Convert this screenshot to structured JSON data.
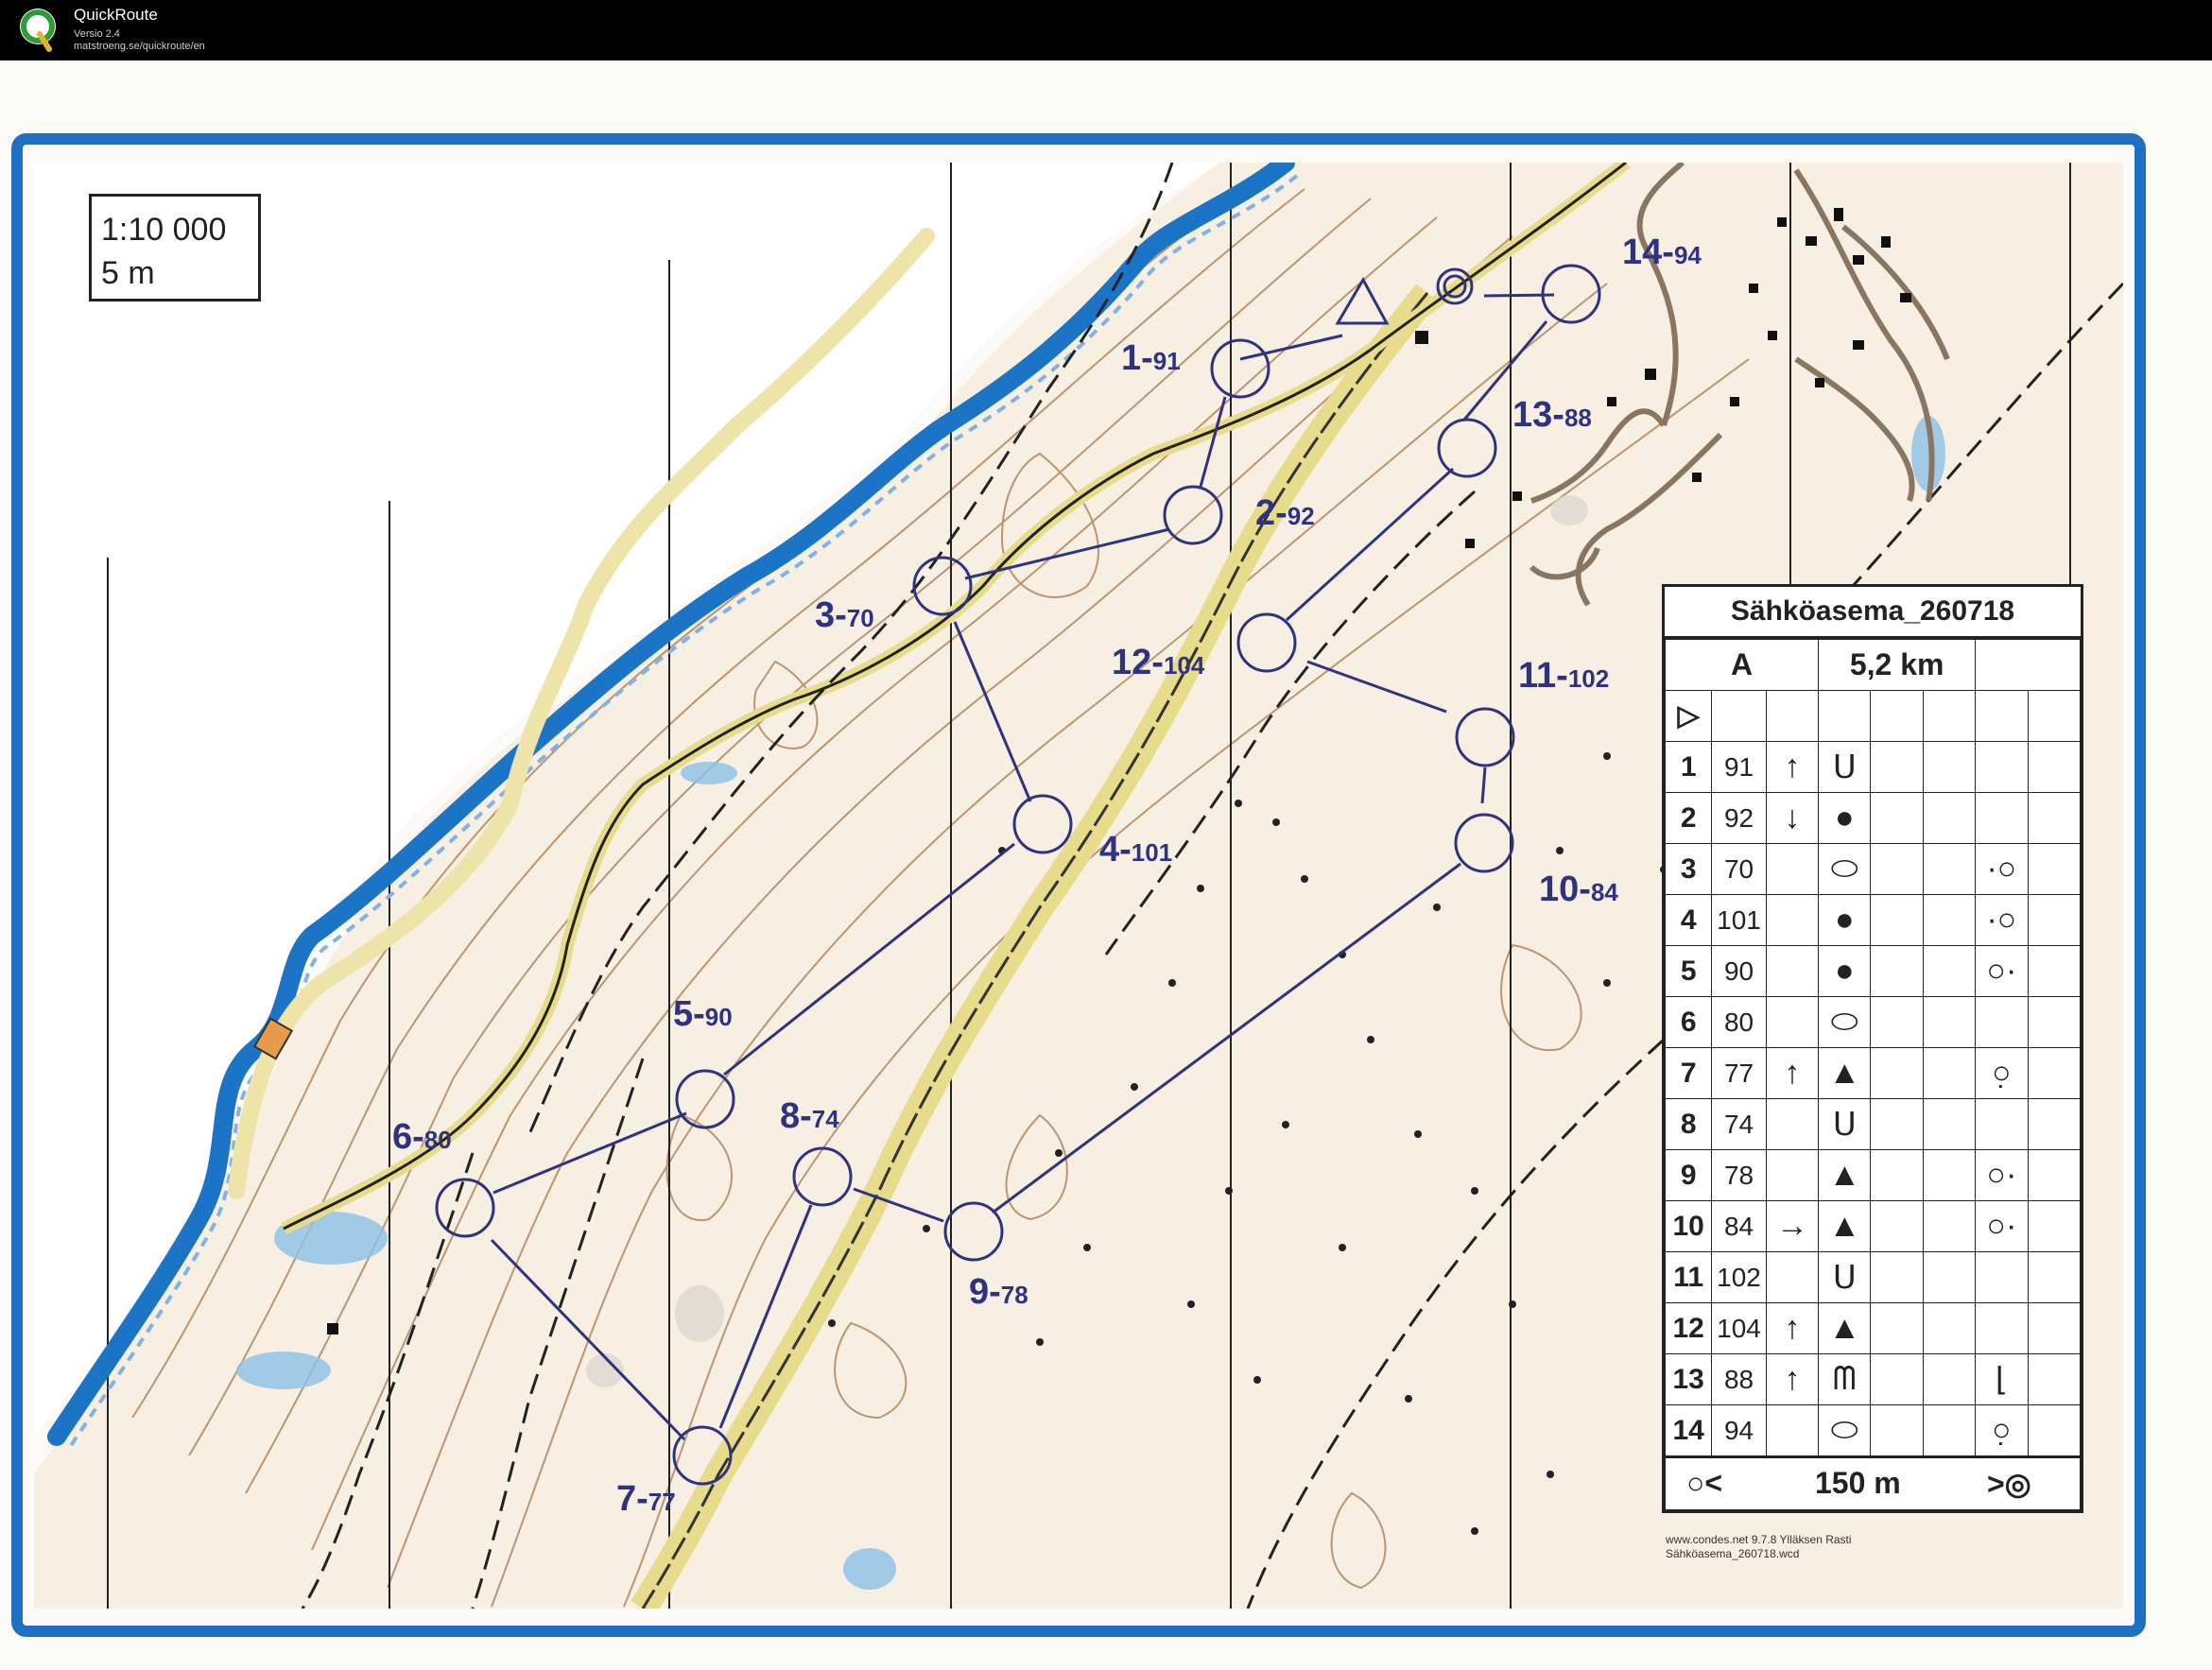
{
  "app": {
    "name": "QuickRoute",
    "version": "Versio 2.4",
    "url": "matstroeng.se/quickroute/en"
  },
  "map": {
    "scale": "1:10 000",
    "contour": "5 m",
    "course_title": "Sähköasema_260718",
    "class": "A",
    "length": "5,2 km",
    "start_symbol": "▷",
    "footer_left_symbol": "○<",
    "footer_distance": "150 m",
    "footer_right_symbol": ">◎",
    "software_note": "www.condes.net 9.7.8 Ylläksen Rasti",
    "file_name": "Sähköasema_260718.wcd",
    "colors": {
      "frame": "#1f6fc2",
      "water": "#1c74c6",
      "contours": "#a9774a",
      "course": "#2e3280",
      "track": "#e6dc8c"
    }
  },
  "controls": [
    {
      "num": "1",
      "code": "91",
      "dir": "↑",
      "feature": "ᑌ",
      "pos": ""
    },
    {
      "num": "2",
      "code": "92",
      "dir": "↓",
      "feature": "●",
      "pos": ""
    },
    {
      "num": "3",
      "code": "70",
      "dir": "",
      "feature": "⬭",
      "pos": "·○"
    },
    {
      "num": "4",
      "code": "101",
      "dir": "",
      "feature": "●",
      "pos": "·○"
    },
    {
      "num": "5",
      "code": "90",
      "dir": "",
      "feature": "●",
      "pos": "○·"
    },
    {
      "num": "6",
      "code": "80",
      "dir": "",
      "feature": "⬭",
      "pos": ""
    },
    {
      "num": "7",
      "code": "77",
      "dir": "↑",
      "feature": "▲",
      "pos": "○̣"
    },
    {
      "num": "8",
      "code": "74",
      "dir": "",
      "feature": "ᑌ",
      "pos": ""
    },
    {
      "num": "9",
      "code": "78",
      "dir": "",
      "feature": "▲",
      "pos": "○·"
    },
    {
      "num": "10",
      "code": "84",
      "dir": "→",
      "feature": "▲",
      "pos": "○·"
    },
    {
      "num": "11",
      "code": "102",
      "dir": "",
      "feature": "ᑌ",
      "pos": ""
    },
    {
      "num": "12",
      "code": "104",
      "dir": "↑",
      "feature": "▲",
      "pos": ""
    },
    {
      "num": "13",
      "code": "88",
      "dir": "↑",
      "feature": "ᗰ",
      "pos": "⌊"
    },
    {
      "num": "14",
      "code": "94",
      "dir": "",
      "feature": "⬭",
      "pos": "○̣"
    }
  ],
  "map_labels": [
    {
      "num": "1",
      "pts": "91"
    },
    {
      "num": "2",
      "pts": "92"
    },
    {
      "num": "3",
      "pts": "70"
    },
    {
      "num": "4",
      "pts": "101"
    },
    {
      "num": "5",
      "pts": "90"
    },
    {
      "num": "6",
      "pts": "80"
    },
    {
      "num": "7",
      "pts": "77"
    },
    {
      "num": "8",
      "pts": "74"
    },
    {
      "num": "9",
      "pts": "78"
    },
    {
      "num": "10",
      "pts": "84"
    },
    {
      "num": "11",
      "pts": "102"
    },
    {
      "num": "12",
      "pts": "104"
    },
    {
      "num": "13",
      "pts": "88"
    },
    {
      "num": "14",
      "pts": "94"
    }
  ]
}
